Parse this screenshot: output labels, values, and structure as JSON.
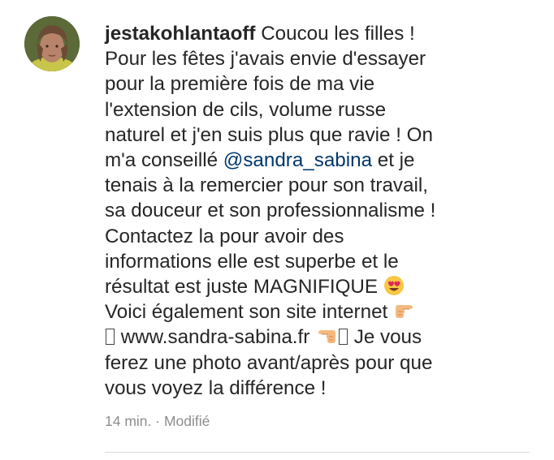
{
  "comment": {
    "username": "jestakohlantaoff",
    "lines": {
      "l1_text": " Coucou les filles !",
      "l2": "Pour les fêtes j'avais envie d'essayer",
      "l3": "pour la première fois de ma vie",
      "l4": "l'extension de cils, volume russe",
      "l5": "naturel et j'en suis plus que ravie ! On",
      "l6_before": "m'a conseillé ",
      "l6_mention": "@sandra_sabina",
      "l6_after": " et je",
      "l7": "tenais à la remercier pour son travail,",
      "l8": "sa douceur et son professionnalisme !",
      "l9": "Contactez la pour avoir des",
      "l10": "informations elle est superbe et le",
      "l11_text": "résultat est juste MAGNIFIQUE ",
      "l12_text": "Voici également son site internet ",
      "l13_url": " www.sandra-sabina.fr ",
      "l13_after": " Je vous",
      "l14": "ferez une photo avant/après pour que",
      "l15": "vous voyez la différence !"
    },
    "emoji": {
      "heart_eyes": "heart-eyes-emoji",
      "pointing_right": "backhand-index-pointing-right-emoji",
      "pointing_left": "backhand-index-pointing-left-emoji",
      "missing_glyph": "unsupported-character-box"
    },
    "meta": {
      "time": "14 min.",
      "separator": " · ",
      "edited": "Modifié"
    }
  },
  "colors": {
    "text": "#262626",
    "mention": "#00376b",
    "meta": "#8e8e8e",
    "divider": "#dbdbdb"
  }
}
